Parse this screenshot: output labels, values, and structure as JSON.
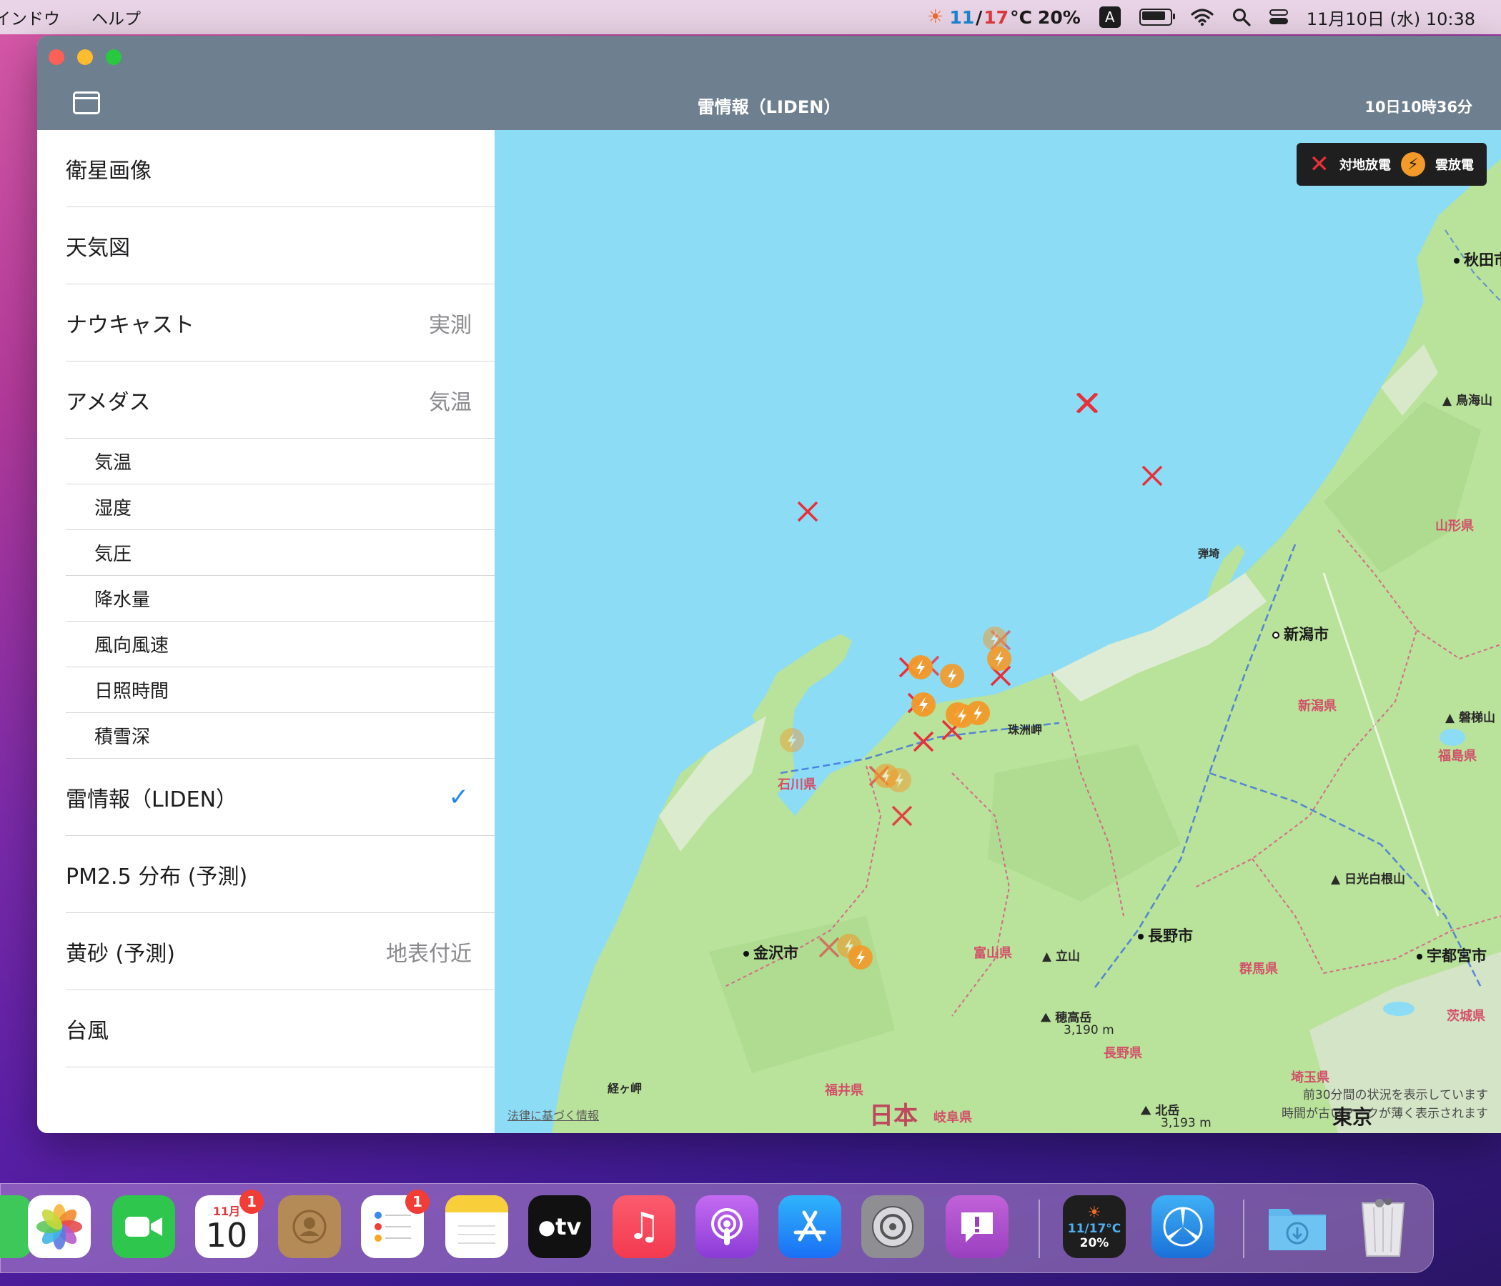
{
  "menubar": {
    "menu_items": [
      "インドウ",
      "ヘルプ"
    ],
    "weather_low": "11",
    "weather_slash": "/",
    "weather_high": "17",
    "weather_unit": "°C",
    "weather_pct": "20%",
    "input_method": "A",
    "datetime": "11月10日 (水)  10:38"
  },
  "window": {
    "title": "雷情報（LIDEN）",
    "timestamp": "10日10時36分"
  },
  "sidebar": {
    "items": [
      {
        "label": "衛星画像",
        "value": ""
      },
      {
        "label": "天気図",
        "value": ""
      },
      {
        "label": "ナウキャスト",
        "value": "実測"
      },
      {
        "label": "アメダス",
        "value": "気温"
      },
      {
        "label": "気温",
        "value": ""
      },
      {
        "label": "湿度",
        "value": ""
      },
      {
        "label": "気圧",
        "value": ""
      },
      {
        "label": "降水量",
        "value": ""
      },
      {
        "label": "風向風速",
        "value": ""
      },
      {
        "label": "日照時間",
        "value": ""
      },
      {
        "label": "積雪深",
        "value": ""
      },
      {
        "label": "雷情報（LIDEN）",
        "value": "",
        "selected": true,
        "check": "✓"
      },
      {
        "label": "PM2.5 分布 (予測)",
        "value": ""
      },
      {
        "label": "黄砂 (予測)",
        "value": "地表付近"
      },
      {
        "label": "台風",
        "value": ""
      }
    ]
  },
  "map": {
    "legend": {
      "ground_label": "対地放電",
      "cloud_label": "雲放電"
    },
    "labels": {
      "akita": "秋田市",
      "chokai": "鳥海山",
      "yamagata": "山形県",
      "hajikizaki": "弾埼",
      "niigata_city": "新潟市",
      "niigata_pref": "新潟県",
      "bandai": "磐梯山",
      "fukushima": "福島県",
      "suzu": "珠洲岬",
      "ishikawa": "石川県",
      "kanazawa": "金沢市",
      "toyama": "富山県",
      "tateyama": "立山",
      "nagano_city": "長野市",
      "gunma": "群馬県",
      "nikko": "日光白根山",
      "utsunomiya": "宇都宮市",
      "ibaraki": "茨城県",
      "hotaka": "穂高岳",
      "hotaka_h": "3,190 m",
      "nagano_pref": "長野県",
      "saitama": "埼玉県",
      "fukui": "福井県",
      "gifu": "岐阜県",
      "japan": "日本",
      "kitadake": "北岳",
      "kitadake_h": "3,193 m",
      "tokyo": "東京",
      "kyogamisaki": "経ヶ岬",
      "legal": "法律に基づく情報"
    },
    "note_line1": "前30分間の状況を表示しています",
    "note_line2": "時間が古いマークが薄く表示されます"
  },
  "dock": {
    "calendar_month": "11月",
    "calendar_day": "10",
    "calendar_badge": "1",
    "reminders_badge": "1",
    "tv_label": "tv",
    "weather_widget_temp": "11/17°C",
    "weather_widget_pct": "20%"
  },
  "colors": {
    "sea": "#8ddcf6",
    "land": "#b9e29a",
    "ground_strike": "#e8303a",
    "cloud_strike": "#f39a2a",
    "titlebar": "#6e7f90",
    "check": "#1a86f5"
  }
}
